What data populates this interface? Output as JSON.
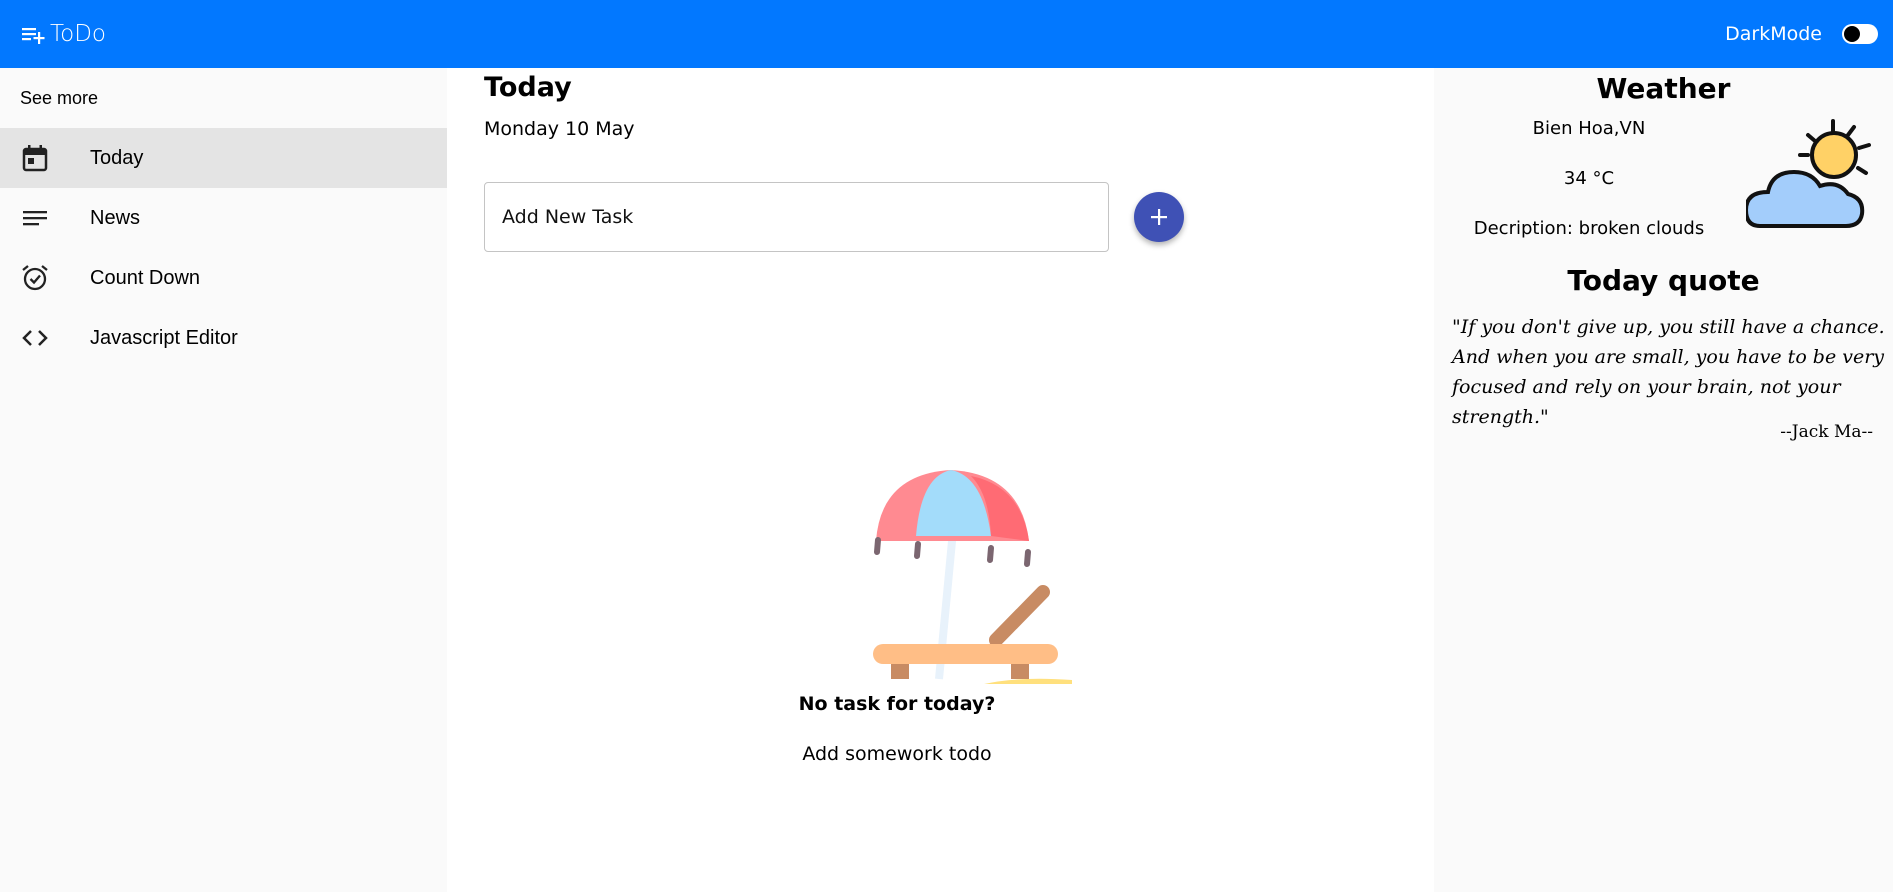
{
  "appbar": {
    "title": "ToDo",
    "darkmode_label": "DarkMode",
    "darkmode_on": false
  },
  "sidebar": {
    "see_more": "See more",
    "items": [
      {
        "label": "Today",
        "icon": "calendar-icon",
        "active": true
      },
      {
        "label": "News",
        "icon": "lines-icon",
        "active": false
      },
      {
        "label": "Count Down",
        "icon": "alarm-icon",
        "active": false
      },
      {
        "label": "Javascript Editor",
        "icon": "code-icon",
        "active": false
      }
    ]
  },
  "main": {
    "title": "Today",
    "date": "Monday 10 May",
    "task_placeholder": "Add New Task",
    "add_button_icon": "plus-icon",
    "empty_title": "No task for today?",
    "empty_subtitle": "Add somework todo",
    "empty_illustration": "beach-umbrella-chair-icon"
  },
  "weather": {
    "title": "Weather",
    "location": "Bien Hoa,VN",
    "temperature": "34 °C",
    "description": "Decription: broken clouds",
    "icon": "sun-cloud-icon"
  },
  "quote": {
    "title": "Today quote",
    "text": "\"If you don't give up, you still have a chance. And when you are small, you have to be very focused and rely on your brain, not your strength.\"",
    "author": "--Jack Ma--"
  },
  "colors": {
    "appbar": "#0278ff",
    "add_button": "#3f51b5",
    "active_nav": "#e4e4e4"
  }
}
